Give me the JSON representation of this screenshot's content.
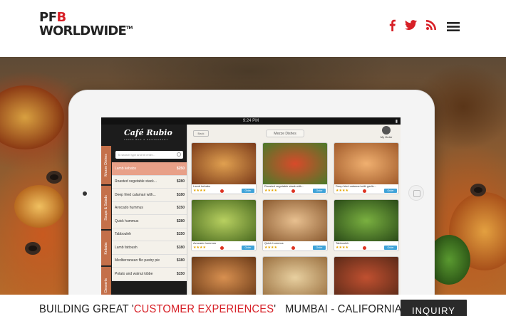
{
  "header": {
    "logo_line1_pf": "PF",
    "logo_line1_b": "B",
    "logo_line2": "WORLDWIDE",
    "logo_tm": "TM",
    "social": [
      "facebook-icon",
      "twitter-icon",
      "rss-icon"
    ],
    "menu_icon": "hamburger-menu-icon"
  },
  "app": {
    "status_time": "9:24 PM",
    "brand": "Café Rubio",
    "brand_sub": "TAPAS BAR & RESTAURANT",
    "search_placeholder": "To search type and hit enter...",
    "side_tabs": [
      "Mezze Dishes",
      "Soups & Salads",
      "Kebabs",
      "Desserts"
    ],
    "menu_items": [
      {
        "name": "Lamb kebabs",
        "price": "$250"
      },
      {
        "name": "Roasted vegetable stack...",
        "price": "$280"
      },
      {
        "name": "Deep fried calamari with...",
        "price": "$180"
      },
      {
        "name": "Avocado hummus",
        "price": "$150"
      },
      {
        "name": "Quick hummus",
        "price": "$280"
      },
      {
        "name": "Tabbouleh",
        "price": "$150"
      },
      {
        "name": "Lamb fattoush",
        "price": "$180"
      },
      {
        "name": "Mediterranean filo pastry pie",
        "price": "$180"
      },
      {
        "name": "Potato and walnut kibbe",
        "price": "$150"
      }
    ],
    "back_label": "Back",
    "section_title": "Mezze Dishes",
    "my_order": "My Order",
    "order_label": "Order",
    "cards": [
      {
        "caption": "Lamb kebabs"
      },
      {
        "caption": "Roasted vegetable stack with..."
      },
      {
        "caption": "Deep fried calamari with garlic..."
      },
      {
        "caption": "Avocado hummus"
      },
      {
        "caption": "Quick hummus"
      },
      {
        "caption": "Tabbouleh"
      },
      {
        "caption": ""
      },
      {
        "caption": ""
      },
      {
        "caption": ""
      }
    ]
  },
  "band": {
    "tagline_pre": "BUILDING GREAT '",
    "tagline_highlight": "CUSTOMER EXPERIENCES",
    "tagline_post": "'",
    "locations": "MUMBAI - CALIFORNIA",
    "inquiry_label": "INQUIRY"
  },
  "colors": {
    "accent": "#d72027",
    "dark": "#2a2a2a",
    "menu_active": "#e8a088",
    "order_blue": "#3fa3d8"
  }
}
